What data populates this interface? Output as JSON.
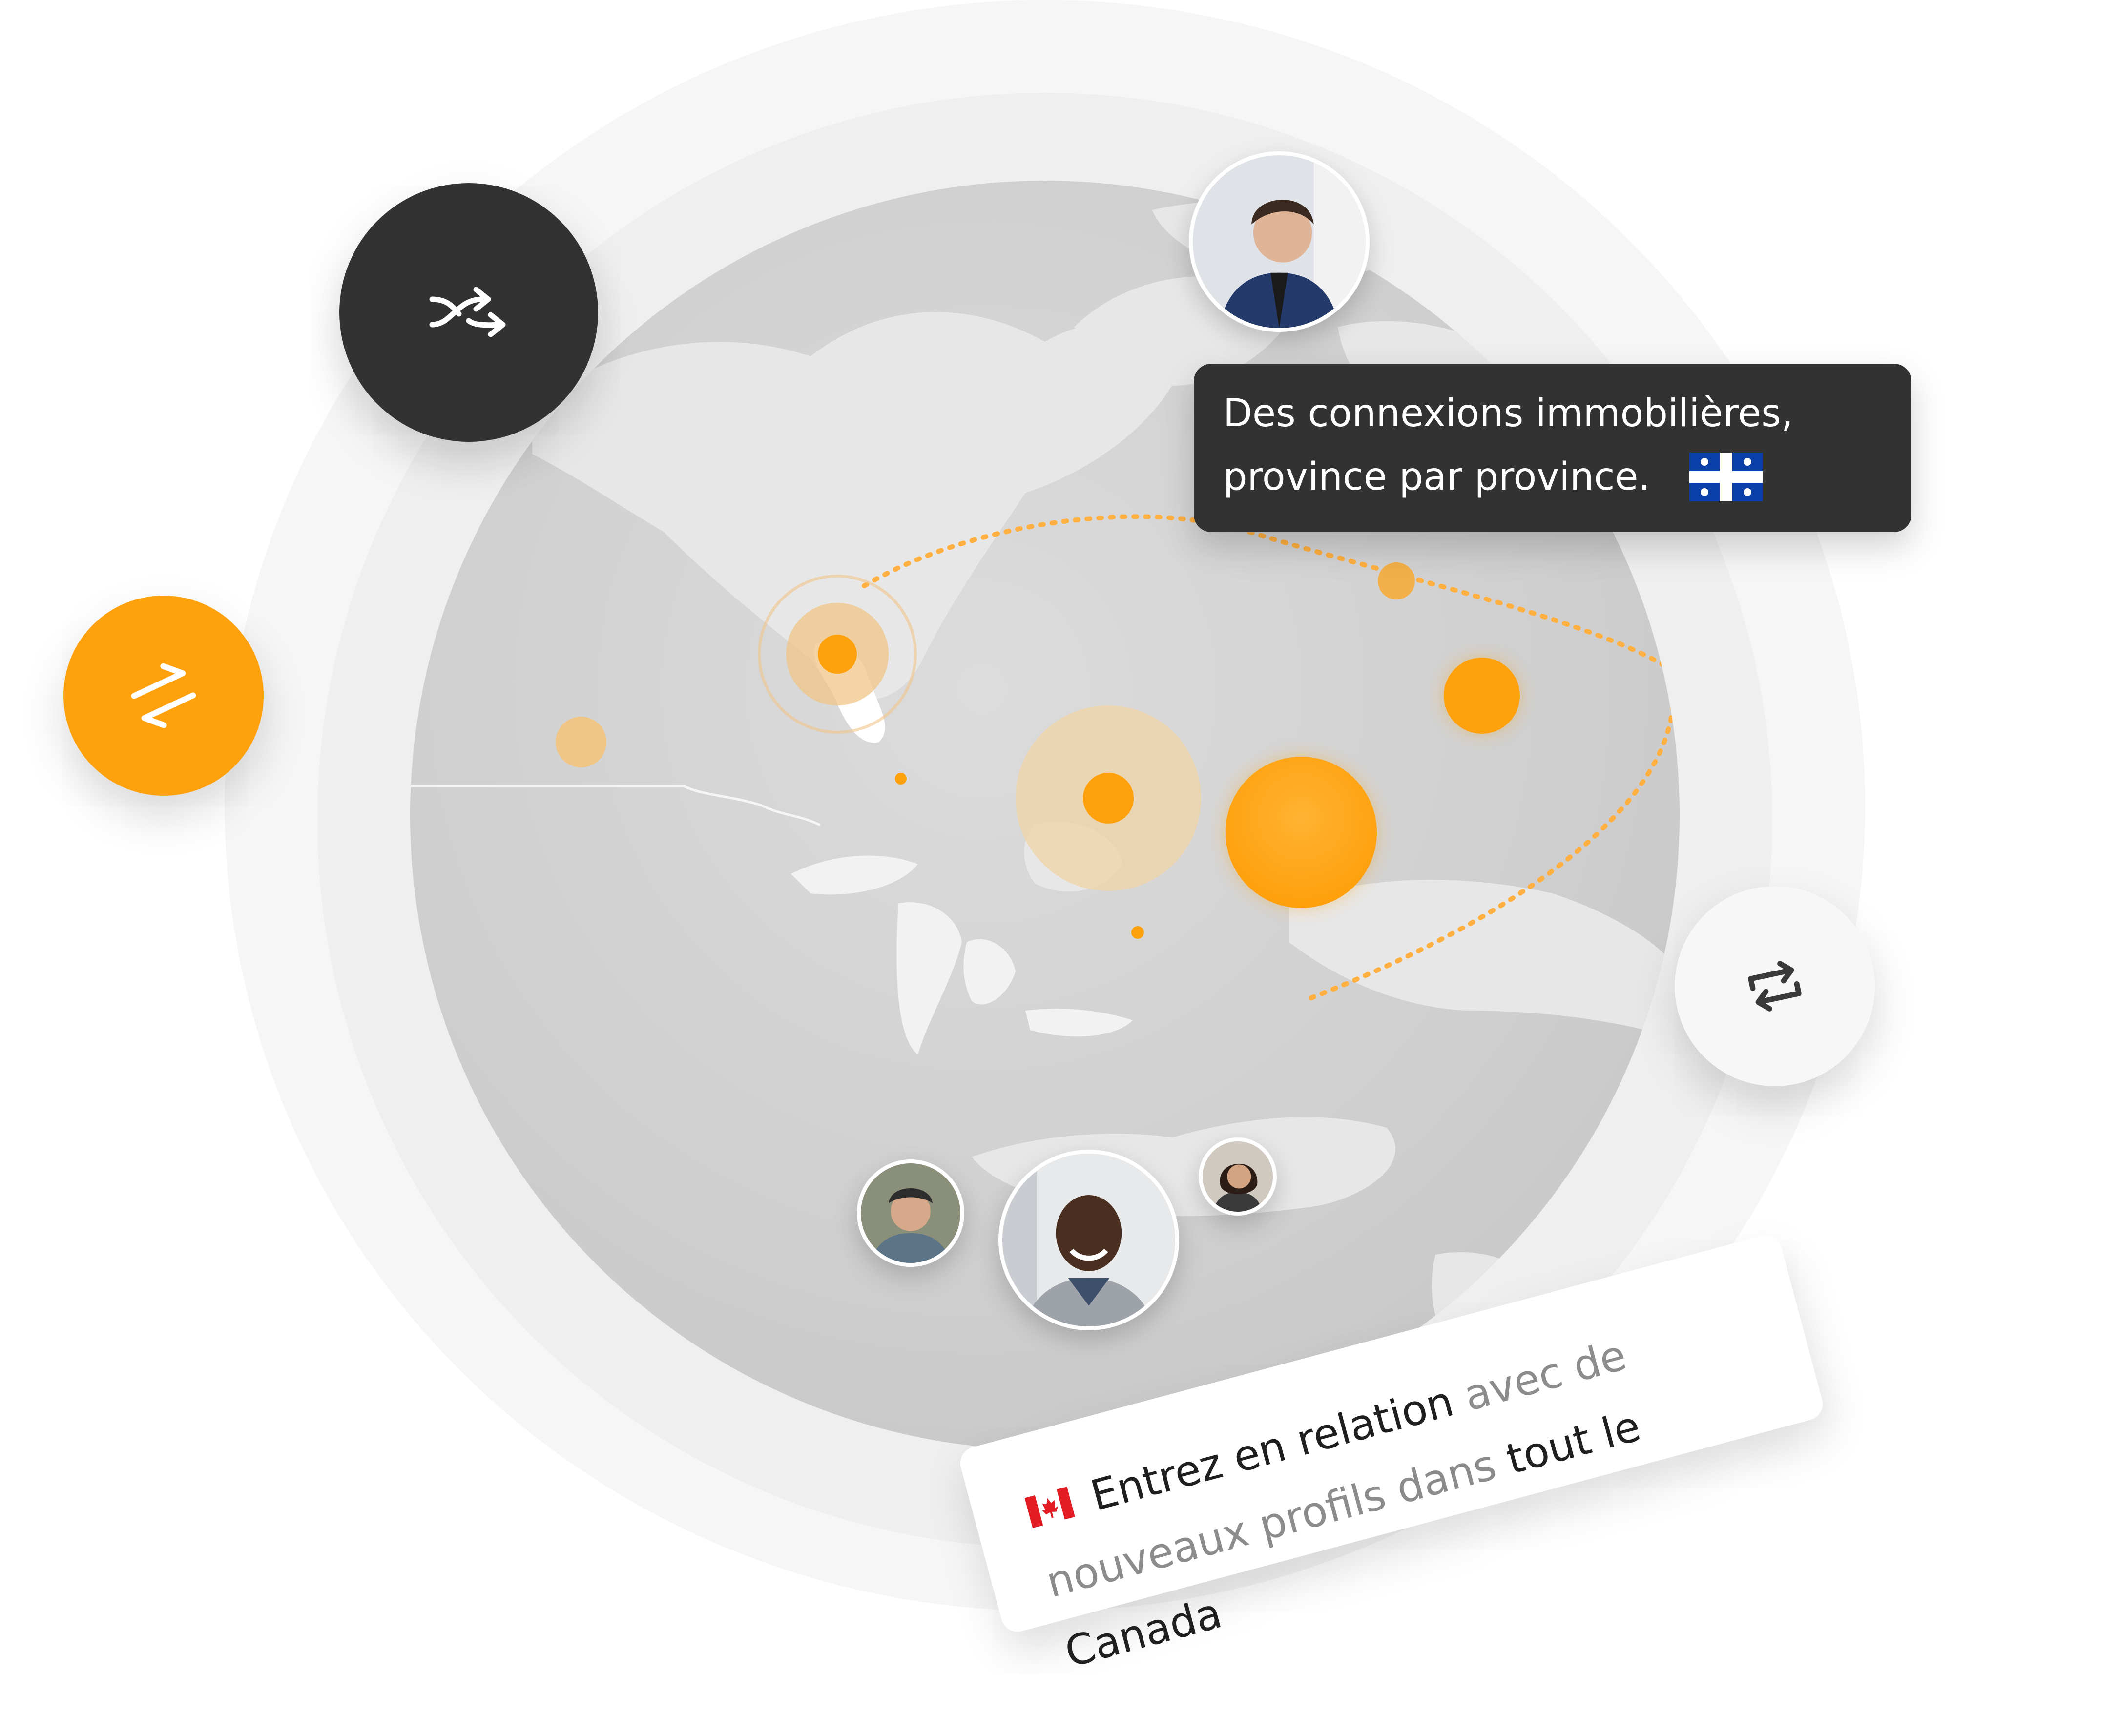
{
  "tooltip": {
    "line1": "Des connexions immobilières,",
    "line2": "province par province.",
    "flag_icon": "quebec-flag-icon"
  },
  "card": {
    "flag_icon": "canada-flag-icon",
    "text_dark_1": "Entrez en relation",
    "text_grey_1": "avec de",
    "text_grey_2": "nouveaux profils dans",
    "text_dark_2": "tout le Canada"
  },
  "buttons": [
    {
      "name": "shuffle-button",
      "icon": "shuffle-icon",
      "color": "#323232"
    },
    {
      "name": "swap-button",
      "icon": "swap-arrows-icon",
      "color": "#ffa10d"
    },
    {
      "name": "repeat-button",
      "icon": "repeat-icon",
      "color": "#f7f7f7"
    }
  ],
  "colors": {
    "accent": "#ffa10d",
    "dark": "#323232",
    "globe": "#cfcfcf",
    "land": "#e6e6e6"
  }
}
